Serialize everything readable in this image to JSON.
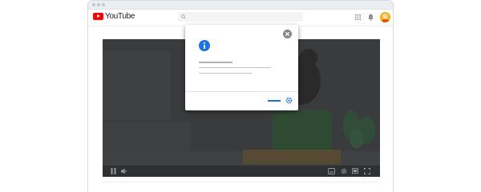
{
  "header": {
    "logo_text": "YouTube",
    "icons": [
      "search-icon",
      "apps-icon",
      "bell-icon",
      "avatar"
    ]
  },
  "player": {
    "controls": [
      "pause-icon",
      "volume-icon",
      "subtitles-icon",
      "settings-icon",
      "cast-icon",
      "fullscreen-icon"
    ]
  },
  "dialog": {
    "icons": [
      "info-icon",
      "close-icon",
      "settings-icon"
    ]
  },
  "colors": {
    "brand_red": "#ff0000",
    "accent_blue": "#1a73e8",
    "overlay_dark": "#3a3b3d"
  }
}
